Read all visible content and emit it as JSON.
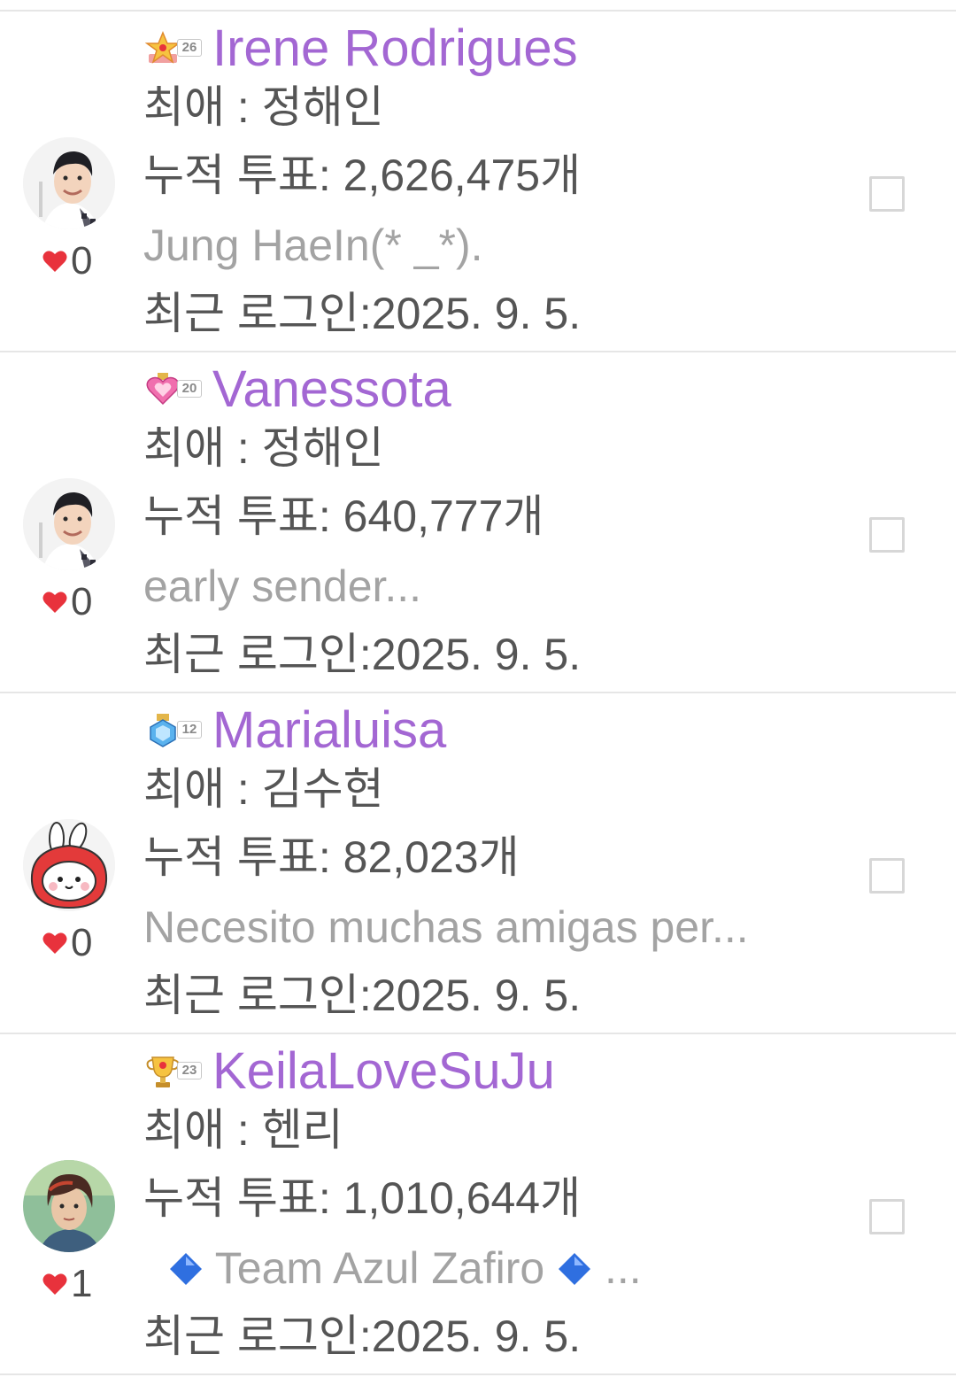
{
  "users": [
    {
      "name": "Irene Rodrigues",
      "level": "26",
      "badge_icon": "star-medal-icon",
      "favorite": "최애 : 정해인",
      "votes": "누적 투표: 2,626,475개",
      "status": " Jung HaeIn(* _*).",
      "last_login": "최근 로그인:2025. 9. 5.",
      "likes": "0",
      "avatar_icon": "profile-photo-man"
    },
    {
      "name": "Vanessota",
      "level": "20",
      "badge_icon": "heart-medal-icon",
      "favorite": "최애 : 정해인",
      "votes": "누적 투표: 640,777개",
      "status": "early sender...",
      "last_login": "최근 로그인:2025. 9. 5.",
      "likes": "0",
      "avatar_icon": "profile-photo-man"
    },
    {
      "name": "Marialuisa",
      "level": "12",
      "badge_icon": "diamond-medal-icon",
      "favorite": "최애 : 김수현",
      "votes": "누적 투표: 82,023개",
      "status": "Necesito muchas amigas per...",
      "last_login": "최근 로그인:2025. 9. 5.",
      "likes": "0",
      "avatar_icon": "bunny-character-avatar"
    },
    {
      "name": "KeilaLoveSuJu",
      "level": "23",
      "badge_icon": "trophy-medal-icon",
      "favorite": "최애 : 헨리",
      "votes": "누적 투표: 1,010,644개",
      "status_prefix": "  ",
      "status_text": " Team Azul Zafiro ",
      "status_suffix": " ...",
      "last_login": "최근 로그인:2025. 9. 5.",
      "likes": "1",
      "avatar_icon": "profile-photo-man"
    }
  ],
  "colors": {
    "username": "#a367d3",
    "text": "#555555",
    "status": "#a3a3a3",
    "heart": "#e8323c",
    "divider": "#e6e6e6"
  }
}
